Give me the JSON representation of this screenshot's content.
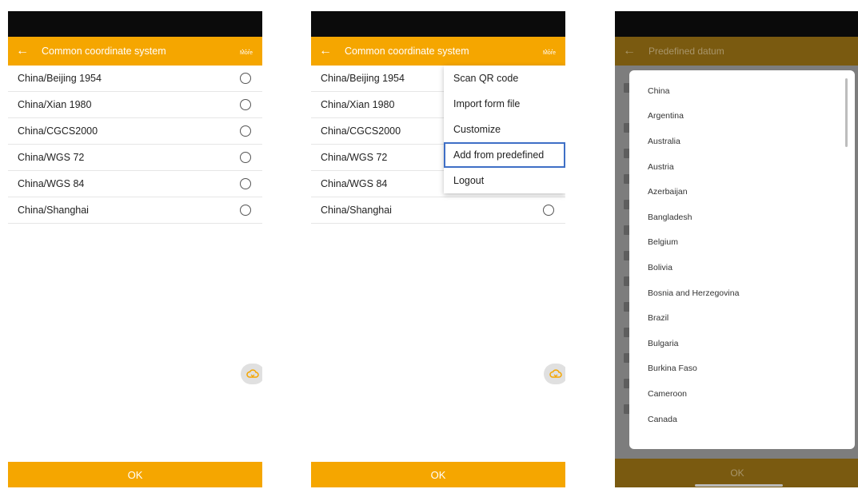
{
  "screen1": {
    "title": "Common coordinate system",
    "more_label": "More",
    "more_dots": "...",
    "back_glyph": "←",
    "items": [
      {
        "label": "China/Beijing 1954"
      },
      {
        "label": "China/Xian 1980"
      },
      {
        "label": "China/CGCS2000"
      },
      {
        "label": "China/WGS 72"
      },
      {
        "label": "China/WGS 84"
      },
      {
        "label": "China/Shanghai"
      }
    ],
    "ok_label": "OK"
  },
  "screen2": {
    "title": "Common coordinate system",
    "more_label": "More",
    "more_dots": "...",
    "back_glyph": "←",
    "items": [
      {
        "label": "China/Beijing 1954"
      },
      {
        "label": "China/Xian 1980"
      },
      {
        "label": "China/CGCS2000"
      },
      {
        "label": "China/WGS 72"
      },
      {
        "label": "China/WGS 84"
      },
      {
        "label": "China/Shanghai"
      }
    ],
    "menu": [
      {
        "label": "Scan QR code"
      },
      {
        "label": "Import form file"
      },
      {
        "label": "Customize"
      },
      {
        "label": "Add from predefined"
      },
      {
        "label": "Logout"
      }
    ],
    "ok_label": "OK"
  },
  "screen3": {
    "title": "Predefined datum",
    "back_glyph": "←",
    "countries": [
      "China",
      "Argentina",
      "Australia",
      "Austria",
      "Azerbaijan",
      "Bangladesh",
      "Belgium",
      "Bolivia",
      "Bosnia and Herzegovina",
      "Brazil",
      "Bulgaria",
      "Burkina Faso",
      "Cameroon",
      "Canada"
    ],
    "ok_label": "OK"
  },
  "colors": {
    "accent": "#f5a600",
    "highlight_outline": "#3e6fc6"
  }
}
